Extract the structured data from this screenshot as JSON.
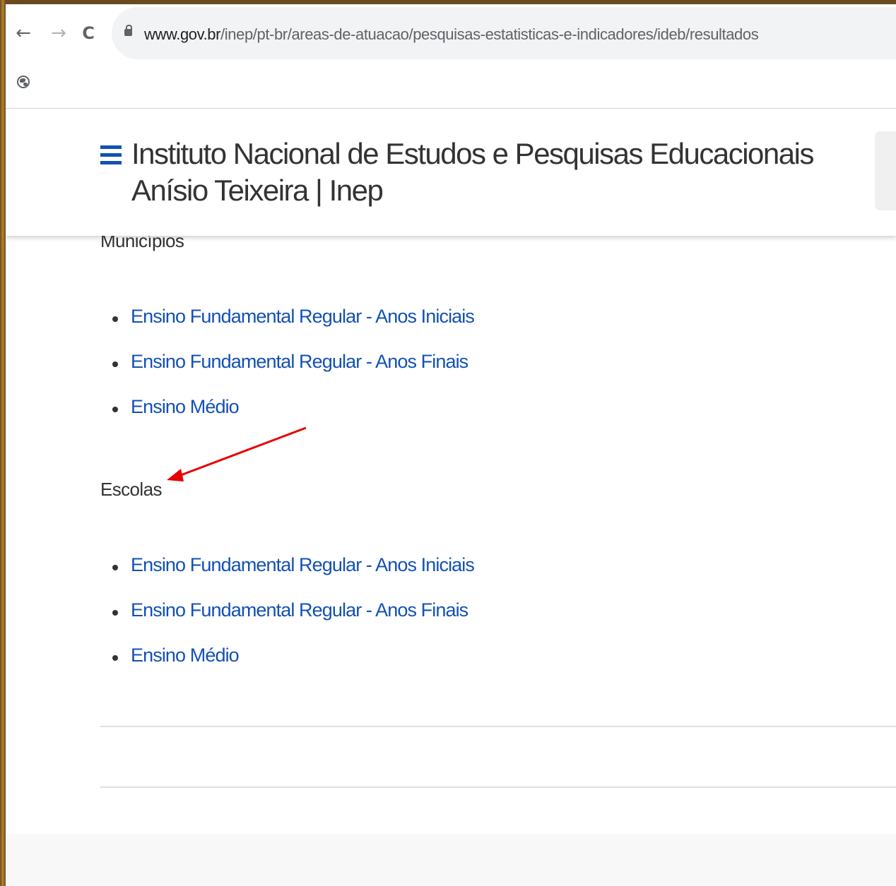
{
  "browser": {
    "back_icon": "arrow-left-icon",
    "forward_icon": "arrow-right-icon",
    "reload_icon": "reload-icon",
    "back_glyph": "←",
    "forward_glyph": "→",
    "reload_glyph": "C",
    "url_host": "www.gov.br",
    "url_path": "/inep/pt-br/areas-de-atuacao/pesquisas-estatisticas-e-indicadores/ideb/resultados"
  },
  "header": {
    "title": "Instituto Nacional de Estudos e Pesquisas Educacionais Anísio Teixeira | Inep"
  },
  "sections": [
    {
      "heading": "Municípios",
      "links": [
        "Ensino Fundamental Regular - Anos Iniciais",
        "Ensino Fundamental Regular - Anos Finais",
        "Ensino Médio"
      ]
    },
    {
      "heading": "Escolas",
      "links": [
        "Ensino Fundamental Regular - Anos Iniciais",
        "Ensino Fundamental Regular - Anos Finais",
        "Ensino Médio"
      ]
    }
  ],
  "colors": {
    "link": "#1351b4",
    "annotation_arrow": "#e60000"
  }
}
